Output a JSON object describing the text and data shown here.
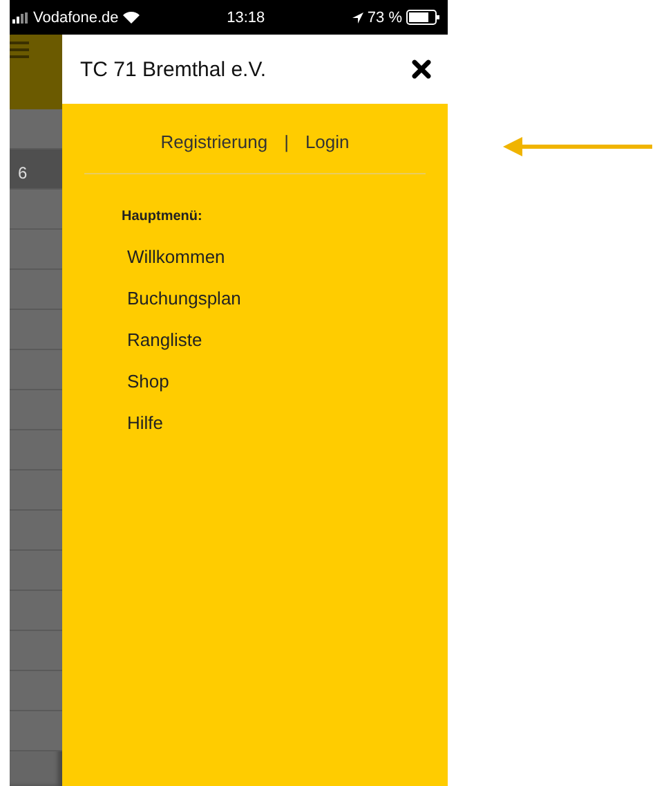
{
  "status_bar": {
    "carrier": "Vodafone.de",
    "time": "13:18",
    "battery": "73 %"
  },
  "background": {
    "cells": [
      {
        "selected": false
      },
      {
        "text": "6",
        "selected": true
      },
      {
        "selected": false
      },
      {
        "selected": false
      },
      {
        "selected": false
      },
      {
        "selected": false
      },
      {
        "selected": false
      },
      {
        "selected": false
      },
      {
        "selected": false
      },
      {
        "selected": false
      },
      {
        "selected": false
      },
      {
        "selected": false
      },
      {
        "selected": false
      },
      {
        "selected": false
      },
      {
        "selected": false
      },
      {
        "selected": false
      }
    ]
  },
  "drawer": {
    "title": "TC 71 Bremthal e.V.",
    "auth_links": [
      "Registrierung",
      "Login"
    ],
    "separator": "|",
    "section_title": "Hauptmenü:",
    "items": [
      {
        "label": "Willkommen"
      },
      {
        "label": "Buchungsplan"
      },
      {
        "label": "Rangliste"
      },
      {
        "label": "Shop"
      },
      {
        "label": "Hilfe"
      }
    ]
  }
}
